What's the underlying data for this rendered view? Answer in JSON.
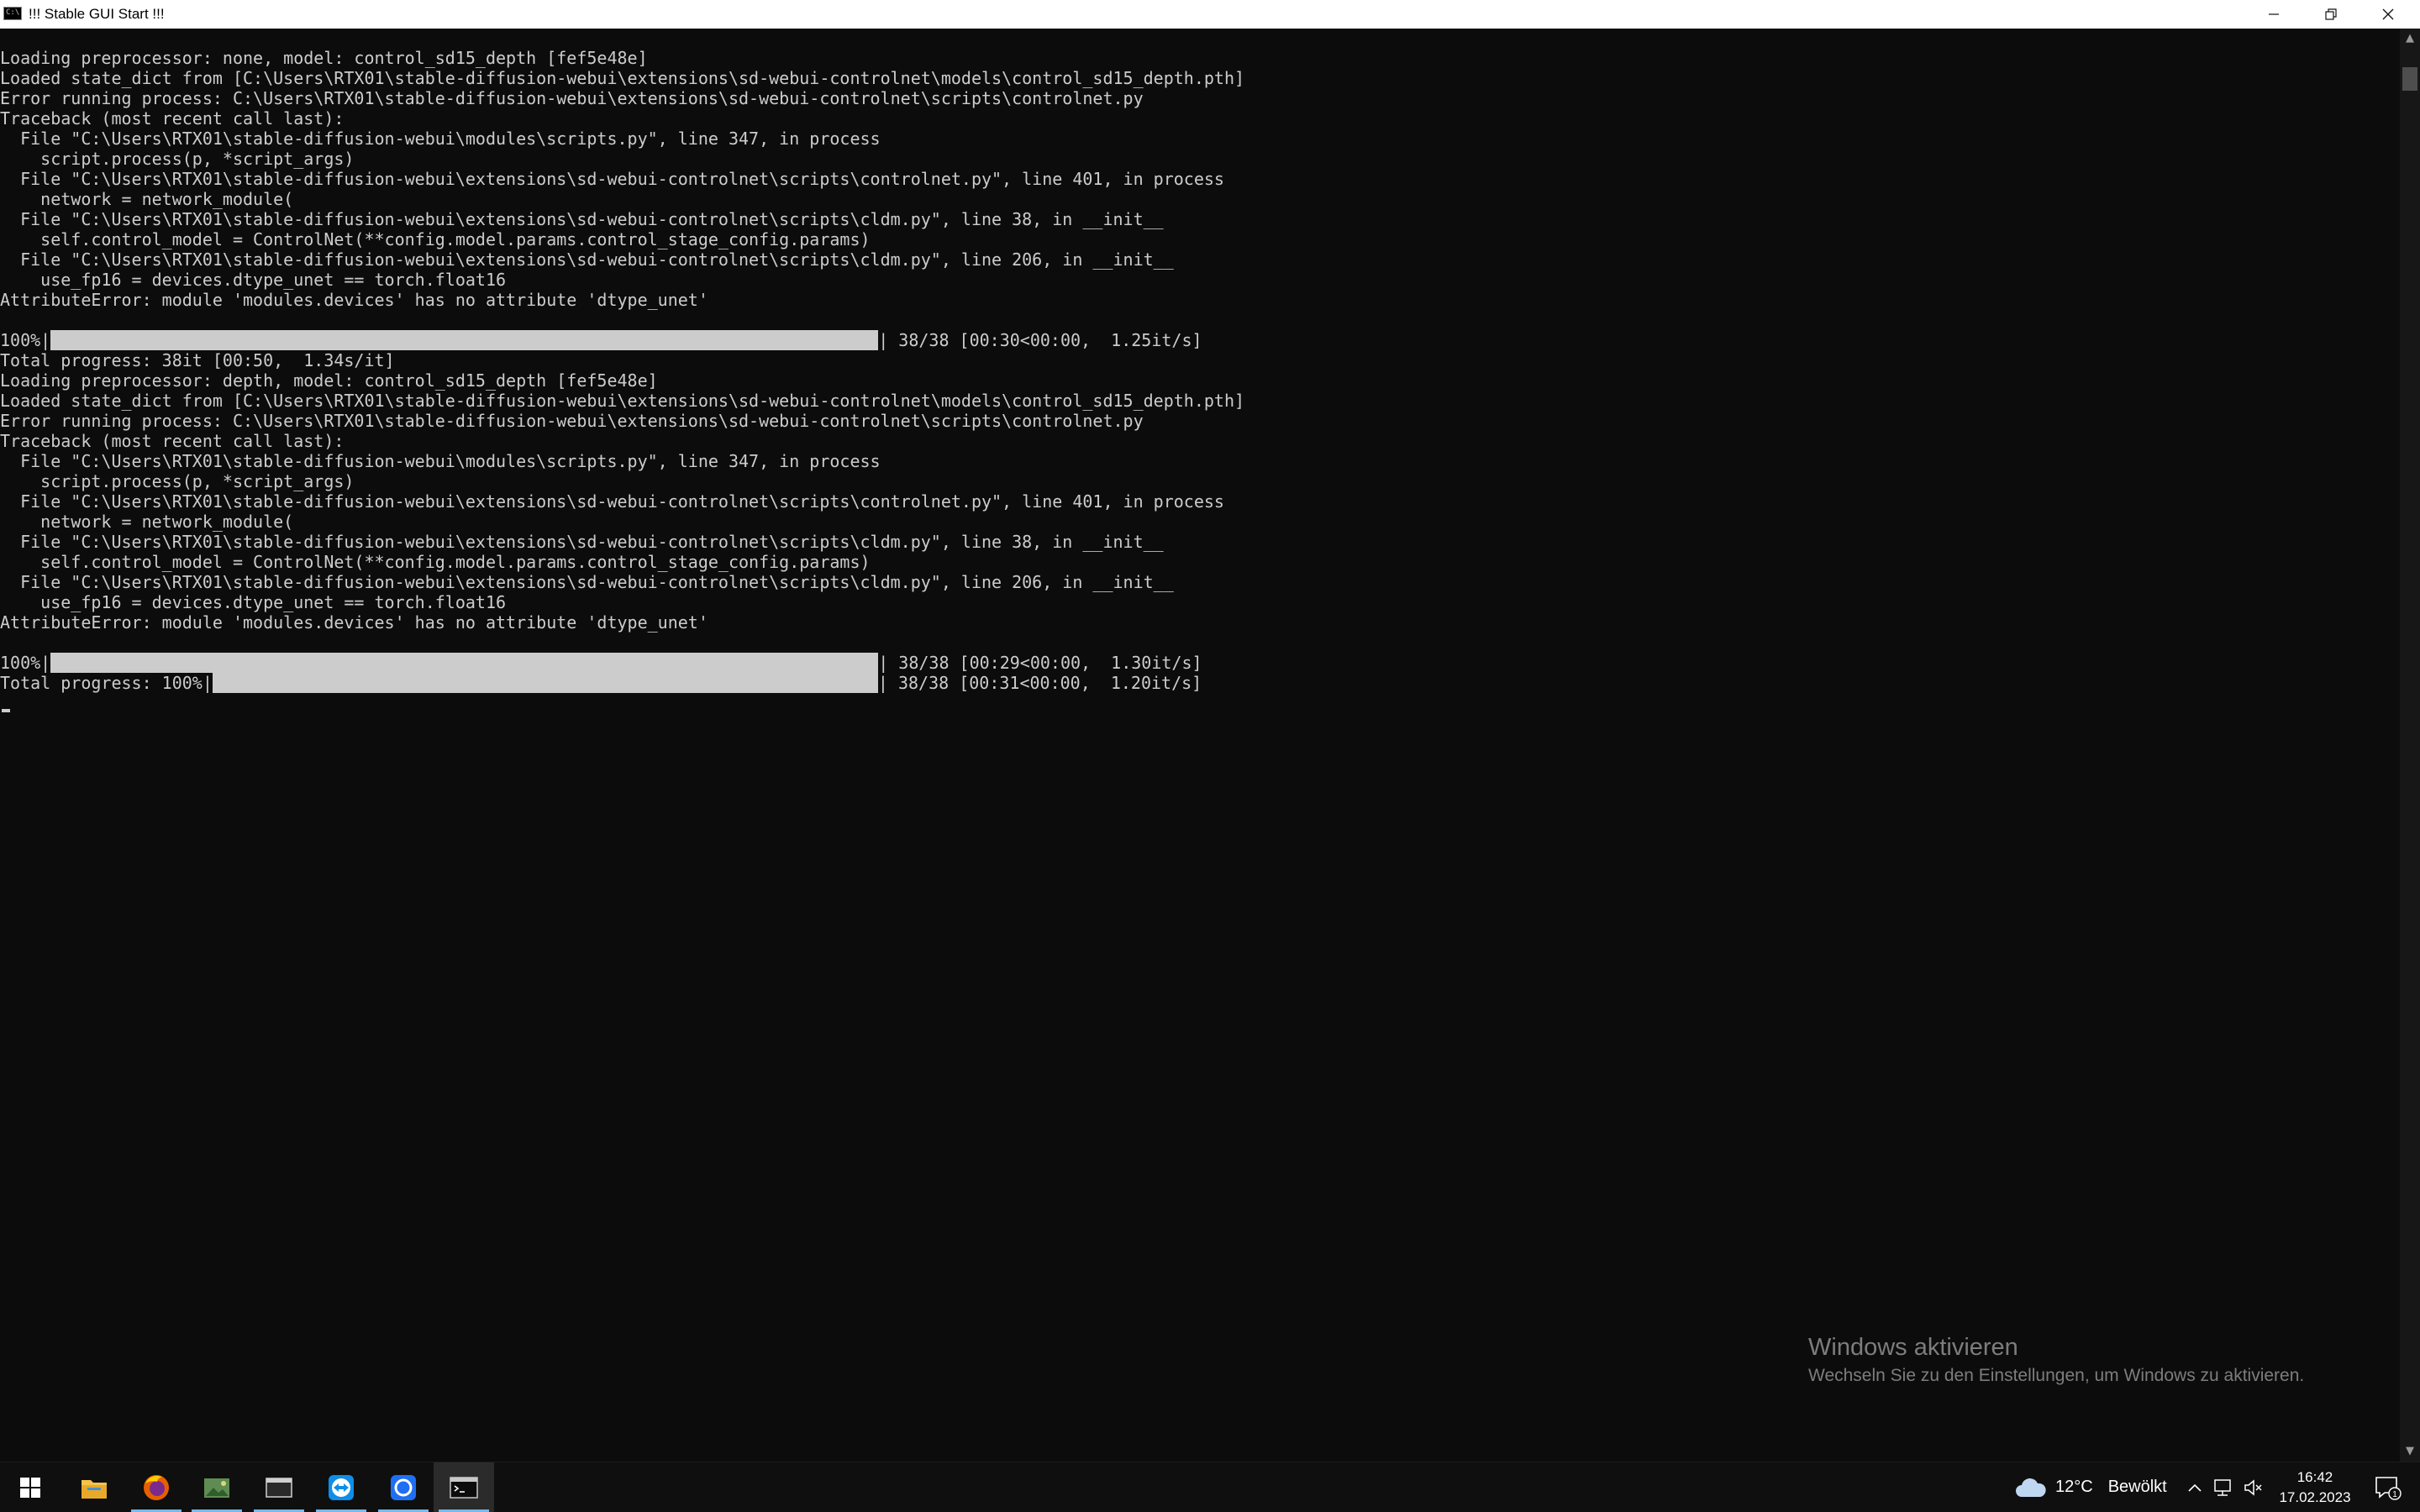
{
  "window": {
    "title": "!!! Stable GUI Start !!!",
    "icon": "console-icon",
    "controls": {
      "minimize": "minimize-icon",
      "maximize": "restore-icon",
      "close": "close-icon"
    }
  },
  "console": {
    "lines": [
      "Loading preprocessor: none, model: control_sd15_depth [fef5e48e]",
      "Loaded state_dict from [C:\\Users\\RTX01\\stable-diffusion-webui\\extensions\\sd-webui-controlnet\\models\\control_sd15_depth.pth]",
      "Error running process: C:\\Users\\RTX01\\stable-diffusion-webui\\extensions\\sd-webui-controlnet\\scripts\\controlnet.py",
      "Traceback (most recent call last):",
      "  File \"C:\\Users\\RTX01\\stable-diffusion-webui\\modules\\scripts.py\", line 347, in process",
      "    script.process(p, *script_args)",
      "  File \"C:\\Users\\RTX01\\stable-diffusion-webui\\extensions\\sd-webui-controlnet\\scripts\\controlnet.py\", line 401, in process",
      "    network = network_module(",
      "  File \"C:\\Users\\RTX01\\stable-diffusion-webui\\extensions\\sd-webui-controlnet\\scripts\\cldm.py\", line 38, in __init__",
      "    self.control_model = ControlNet(**config.model.params.control_stage_config.params)",
      "  File \"C:\\Users\\RTX01\\stable-diffusion-webui\\extensions\\sd-webui-controlnet\\scripts\\cldm.py\", line 206, in __init__",
      "    use_fp16 = devices.dtype_unet == torch.float16",
      "AttributeError: module 'modules.devices' has no attribute 'dtype_unet'",
      "",
      "",
      "Total progress: 38it [00:50,  1.34s/it]",
      "Loading preprocessor: depth, model: control_sd15_depth [fef5e48e]",
      "Loaded state_dict from [C:\\Users\\RTX01\\stable-diffusion-webui\\extensions\\sd-webui-controlnet\\models\\control_sd15_depth.pth]",
      "Error running process: C:\\Users\\RTX01\\stable-diffusion-webui\\extensions\\sd-webui-controlnet\\scripts\\controlnet.py",
      "Traceback (most recent call last):",
      "  File \"C:\\Users\\RTX01\\stable-diffusion-webui\\modules\\scripts.py\", line 347, in process",
      "    script.process(p, *script_args)",
      "  File \"C:\\Users\\RTX01\\stable-diffusion-webui\\extensions\\sd-webui-controlnet\\scripts\\controlnet.py\", line 401, in process",
      "    network = network_module(",
      "  File \"C:\\Users\\RTX01\\stable-diffusion-webui\\extensions\\sd-webui-controlnet\\scripts\\cldm.py\", line 38, in __init__",
      "    self.control_model = ControlNet(**config.model.params.control_stage_config.params)",
      "  File \"C:\\Users\\RTX01\\stable-diffusion-webui\\extensions\\sd-webui-controlnet\\scripts\\cldm.py\", line 206, in __init__",
      "    use_fp16 = devices.dtype_unet == torch.float16",
      "AttributeError: module 'modules.devices' has no attribute 'dtype_unet'",
      ""
    ],
    "progress_1": {
      "prefix": "100%|",
      "stats": "| 38/38 [00:30<00:00,  1.25it/s]",
      "fraction": 1.0
    },
    "progress_2": {
      "prefix": "100%|",
      "stats": "| 38/38 [00:29<00:00,  1.30it/s]",
      "fraction": 1.0
    },
    "progress_3": {
      "prefix": "Total progress: 100%|",
      "stats": "| 38/38 [00:31<00:00,  1.20it/s]",
      "fraction": 1.0
    }
  },
  "watermark": {
    "heading": "Windows aktivieren",
    "text": "Wechseln Sie zu den Einstellungen, um Windows zu aktivieren."
  },
  "taskbar": {
    "apps": [
      {
        "name": "start-icon"
      },
      {
        "name": "file-explorer-icon"
      },
      {
        "name": "firefox-icon"
      },
      {
        "name": "photo-viewer-icon"
      },
      {
        "name": "app-window-icon"
      },
      {
        "name": "teamviewer-icon"
      },
      {
        "name": "app-blue-icon"
      },
      {
        "name": "terminal-icon"
      }
    ],
    "weather": {
      "temp": "12°C",
      "condition": "Bewölkt"
    },
    "clock": {
      "time": "16:42",
      "date": "17.02.2023"
    },
    "notification_count": "1"
  },
  "colors": {
    "console_bg": "#0c0c0c",
    "console_fg": "#cccccc",
    "accent": "#76b9ed"
  }
}
